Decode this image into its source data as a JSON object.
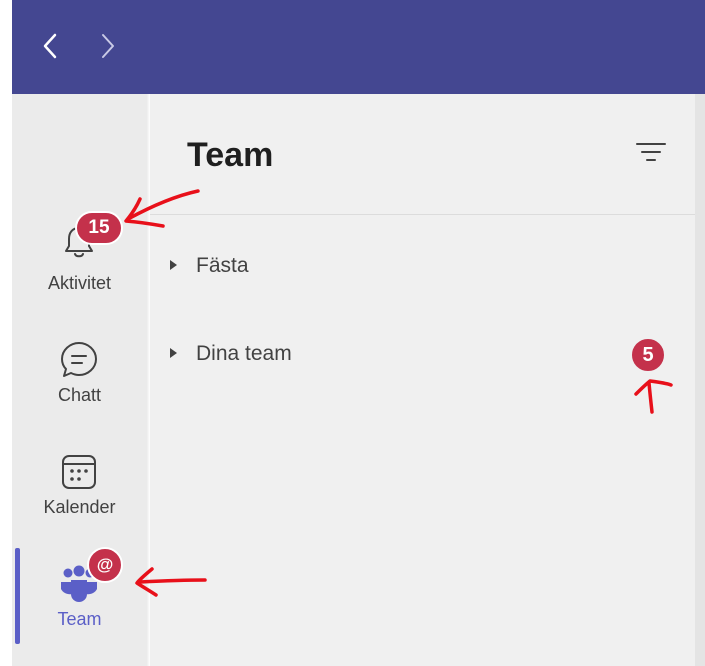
{
  "colors": {
    "topbar": "#444791",
    "rail": "#ebebeb",
    "panel": "#f0f0f0",
    "accent": "#5b5fc7",
    "badge": "#c4314b",
    "annotation": "#e8101a"
  },
  "header": {
    "back_icon": "chevron-left-icon",
    "forward_icon": "chevron-right-icon"
  },
  "rail": {
    "items": [
      {
        "label": "Aktivitet",
        "icon": "bell-icon",
        "badge": "15",
        "active": false
      },
      {
        "label": "Chatt",
        "icon": "chat-icon",
        "active": false
      },
      {
        "label": "Kalender",
        "icon": "calendar-icon",
        "active": false
      },
      {
        "label": "Team",
        "icon": "teams-icon",
        "badge": "@",
        "active": true
      }
    ]
  },
  "panel": {
    "title": "Team",
    "filter_icon": "filter-icon",
    "sections": [
      {
        "label": "Fästa",
        "badge": ""
      },
      {
        "label": "Dina team",
        "badge": "5"
      }
    ]
  }
}
